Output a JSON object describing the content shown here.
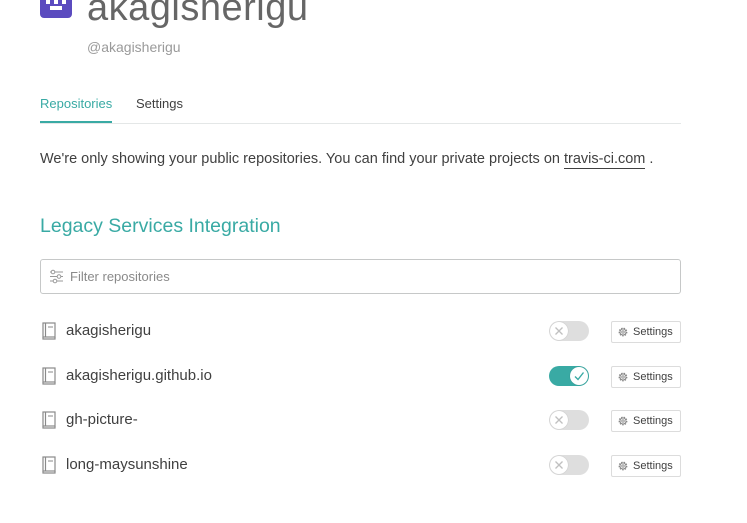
{
  "profile": {
    "name": "akagisherigu",
    "handle": "@akagisherigu"
  },
  "tabs": [
    {
      "label": "Repositories",
      "active": true
    },
    {
      "label": "Settings",
      "active": false
    }
  ],
  "notice": {
    "text": "We're only showing your public repositories. You can find your private projects on",
    "link_text": "travis-ci.com",
    "suffix": "."
  },
  "section": {
    "title": "Legacy Services Integration"
  },
  "filter": {
    "placeholder": "Filter repositories",
    "value": ""
  },
  "repositories": [
    {
      "name": "akagisherigu",
      "enabled": false,
      "settings_label": "Settings"
    },
    {
      "name": "akagisherigu.github.io",
      "enabled": true,
      "settings_label": "Settings"
    },
    {
      "name": "gh-picture-",
      "enabled": false,
      "settings_label": "Settings"
    },
    {
      "name": "long-maysunshine",
      "enabled": false,
      "settings_label": "Settings"
    }
  ],
  "colors": {
    "accent": "#39aaa4",
    "avatar": "#5b4bbf",
    "toggle_off": "#dedede",
    "text": "#404040"
  },
  "icons": {
    "filter": "sliders-icon",
    "repo": "repo-book-icon",
    "toggle_off": "cross-icon",
    "toggle_on": "check-icon",
    "settings": "gear-icon"
  }
}
